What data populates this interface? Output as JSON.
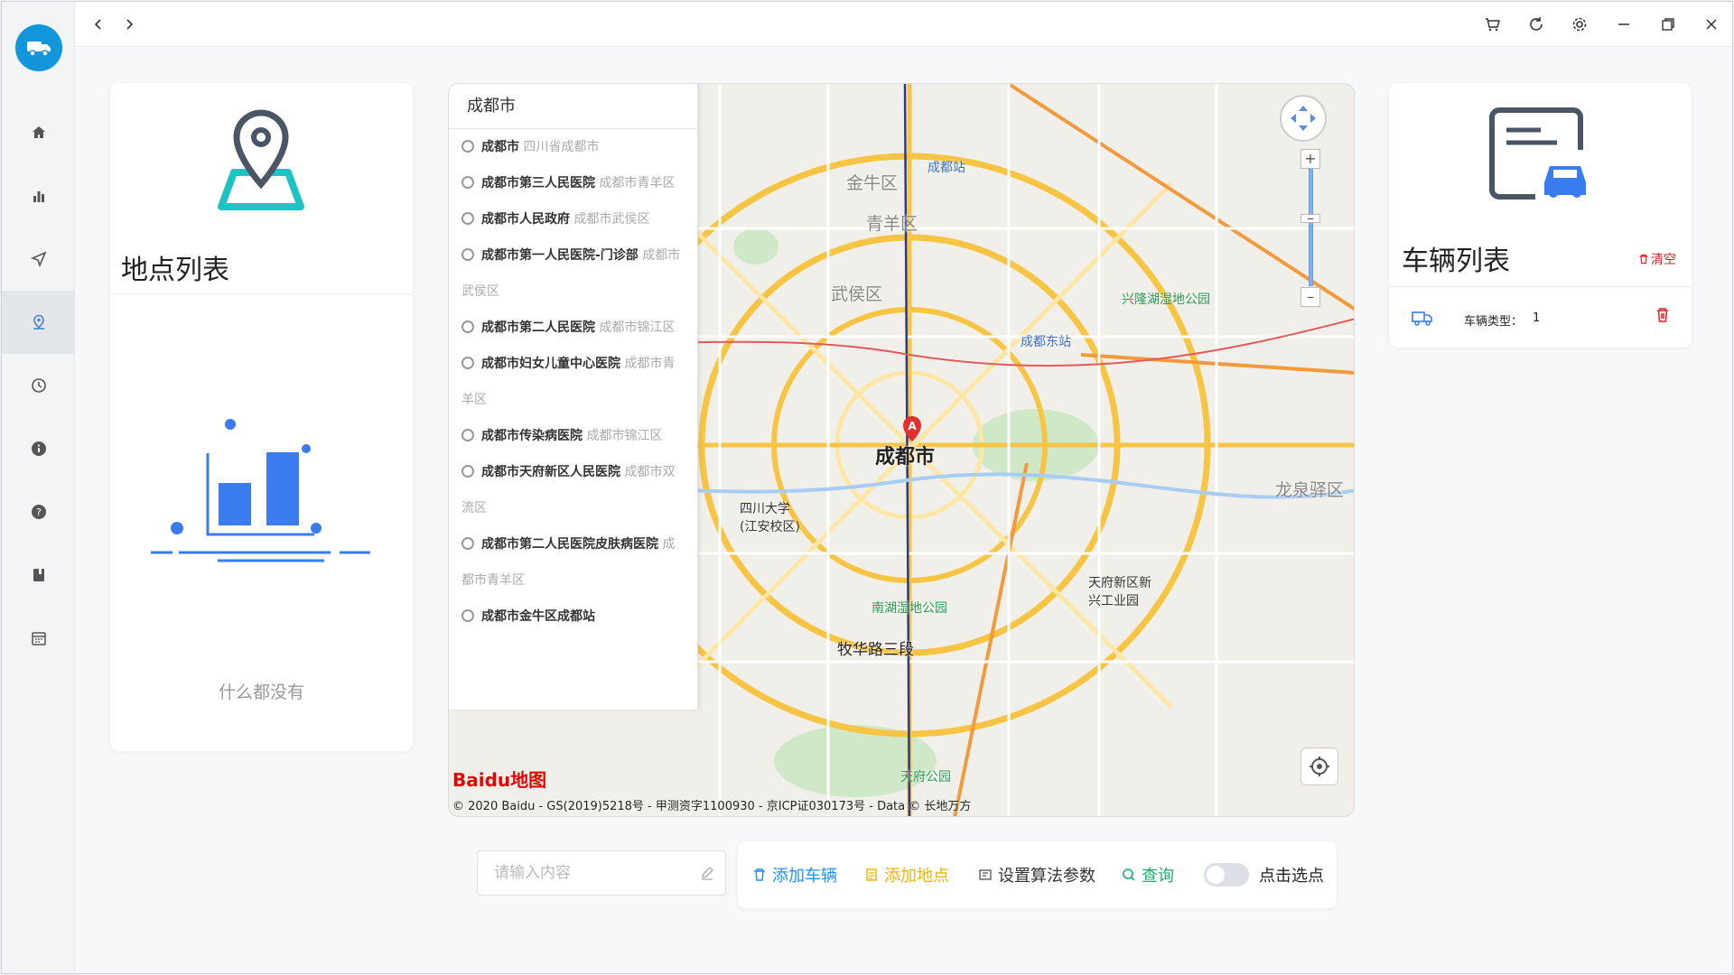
{
  "sidebar": {
    "logo": "truck-logo",
    "items": [
      {
        "name": "home",
        "icon": "home-icon"
      },
      {
        "name": "stats",
        "icon": "bar-chart-icon"
      },
      {
        "name": "navigate",
        "icon": "send-icon"
      },
      {
        "name": "location",
        "icon": "map-pin-icon",
        "active": true
      },
      {
        "name": "history",
        "icon": "clock-icon"
      },
      {
        "name": "info",
        "icon": "info-icon"
      },
      {
        "name": "help",
        "icon": "help-icon"
      },
      {
        "name": "book",
        "icon": "book-icon"
      },
      {
        "name": "calendar",
        "icon": "calendar-icon"
      }
    ]
  },
  "titlebar": {
    "back": "‹",
    "forward": "›"
  },
  "left_panel": {
    "title": "地点列表",
    "empty_text": "什么都没有"
  },
  "map": {
    "search_value": "成都市",
    "suggestions": [
      {
        "name": "成都市",
        "sub": "四川省成都市"
      },
      {
        "name": "成都市第三人民医院",
        "sub": "成都市青羊区"
      },
      {
        "name": "成都市人民政府",
        "sub": "成都市武侯区"
      },
      {
        "name": "成都市第一人民医院-门诊部",
        "sub": "成都市武侯区"
      },
      {
        "name": "成都市第二人民医院",
        "sub": "成都市锦江区"
      },
      {
        "name": "成都市妇女儿童中心医院",
        "sub": "成都市青羊区"
      },
      {
        "name": "成都市传染病医院",
        "sub": "成都市锦江区"
      },
      {
        "name": "成都市天府新区人民医院",
        "sub": "成都市双流区"
      },
      {
        "name": "成都市第二人民医院皮肤病医院",
        "sub": "成都市青羊区"
      },
      {
        "name": "成都市金牛区成都站",
        "sub": ""
      }
    ],
    "labels": {
      "center": "成都市",
      "jinniu": "金牛区",
      "qingyang": "青羊区",
      "wuhou": "武侯区",
      "longquan": "龙泉驿区",
      "chengdu_station": "成都站",
      "chengdu_east": "成都东站",
      "sichuan_univ": "四川大学(江安校区)",
      "tianfu": "天府新区新兴工业园",
      "muhualu": "牧华路三段",
      "xinglongjiao": "兴隆湖湿地公园",
      "tianfu_park": "天府公园",
      "nanhu": "南湖湿地公园"
    },
    "baidu": "Baidu地图",
    "copyright": "© 2020 Baidu - GS(2019)5218号 - 甲测资字1100930 - 京ICP证030173号 - Data © 长地万方"
  },
  "input": {
    "placeholder": "请输入内容"
  },
  "toolbar": {
    "add_vehicle": "添加车辆",
    "add_location": "添加地点",
    "algo_params": "设置算法参数",
    "query": "查询",
    "click_select": "点击选点"
  },
  "right_panel": {
    "title": "车辆列表",
    "clear": "清空",
    "vehicles": [
      {
        "type_label": "车辆类型：",
        "type_value": "1"
      }
    ]
  },
  "colors": {
    "primary": "#1296db",
    "add_vehicle": "#1e90ff",
    "add_location": "#f0b400",
    "query": "#1aae6f",
    "danger": "#e02020"
  }
}
